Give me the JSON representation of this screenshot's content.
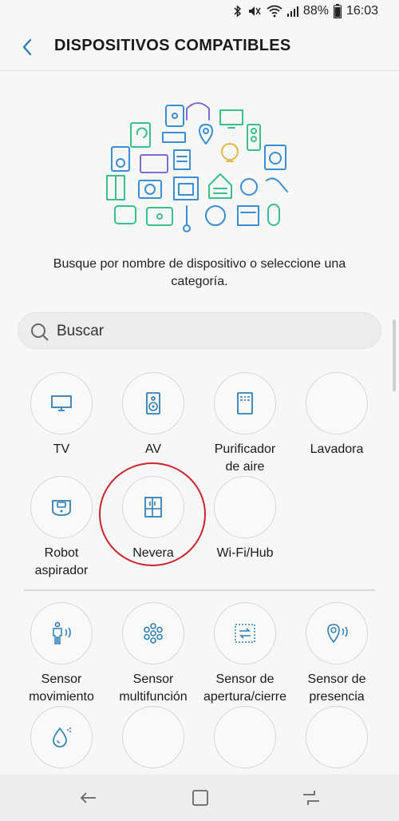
{
  "status": {
    "battery": "88%",
    "time": "16:03"
  },
  "header": {
    "title": "DISPOSITIVOS COMPATIBLES"
  },
  "description": "Busque por nombre de dispositivo o seleccione una categoría.",
  "search": {
    "placeholder": "Buscar"
  },
  "categories": [
    {
      "label_lines": [
        "TV"
      ],
      "icon": "tv-icon"
    },
    {
      "label_lines": [
        "AV"
      ],
      "icon": "speaker-icon"
    },
    {
      "label_lines": [
        "Purificador",
        "de aire"
      ],
      "icon": "air-purifier-icon"
    },
    {
      "label_lines": [
        "Lavadora"
      ],
      "icon": "washer-icon"
    },
    {
      "label_lines": [
        "Robot",
        "aspirador"
      ],
      "icon": "robot-vacuum-icon"
    },
    {
      "label_lines": [
        "Nevera"
      ],
      "icon": "fridge-icon"
    },
    {
      "label_lines": [
        "Wi-Fi/Hub"
      ],
      "icon": "wifi-hub-icon"
    }
  ],
  "sensors": [
    {
      "label_lines": [
        "Sensor",
        "movimiento"
      ],
      "icon": "motion-sensor-icon"
    },
    {
      "label_lines": [
        "Sensor",
        "multifunción"
      ],
      "icon": "multipurpose-sensor-icon"
    },
    {
      "label_lines": [
        "Sensor de",
        "apertura/cierre"
      ],
      "icon": "open-close-sensor-icon"
    },
    {
      "label_lines": [
        "Sensor de",
        "presencia"
      ],
      "icon": "presence-sensor-icon"
    },
    {
      "label_lines": [],
      "icon": "water-leak-icon"
    },
    {
      "label_lines": [],
      "icon": ""
    },
    {
      "label_lines": [],
      "icon": ""
    },
    {
      "label_lines": [],
      "icon": ""
    }
  ],
  "colors": {
    "icon_blue": "#2f7fb5",
    "highlight": "#c8262b",
    "illus_green": "#3bbf8a",
    "illus_blue": "#3a8ed1"
  }
}
